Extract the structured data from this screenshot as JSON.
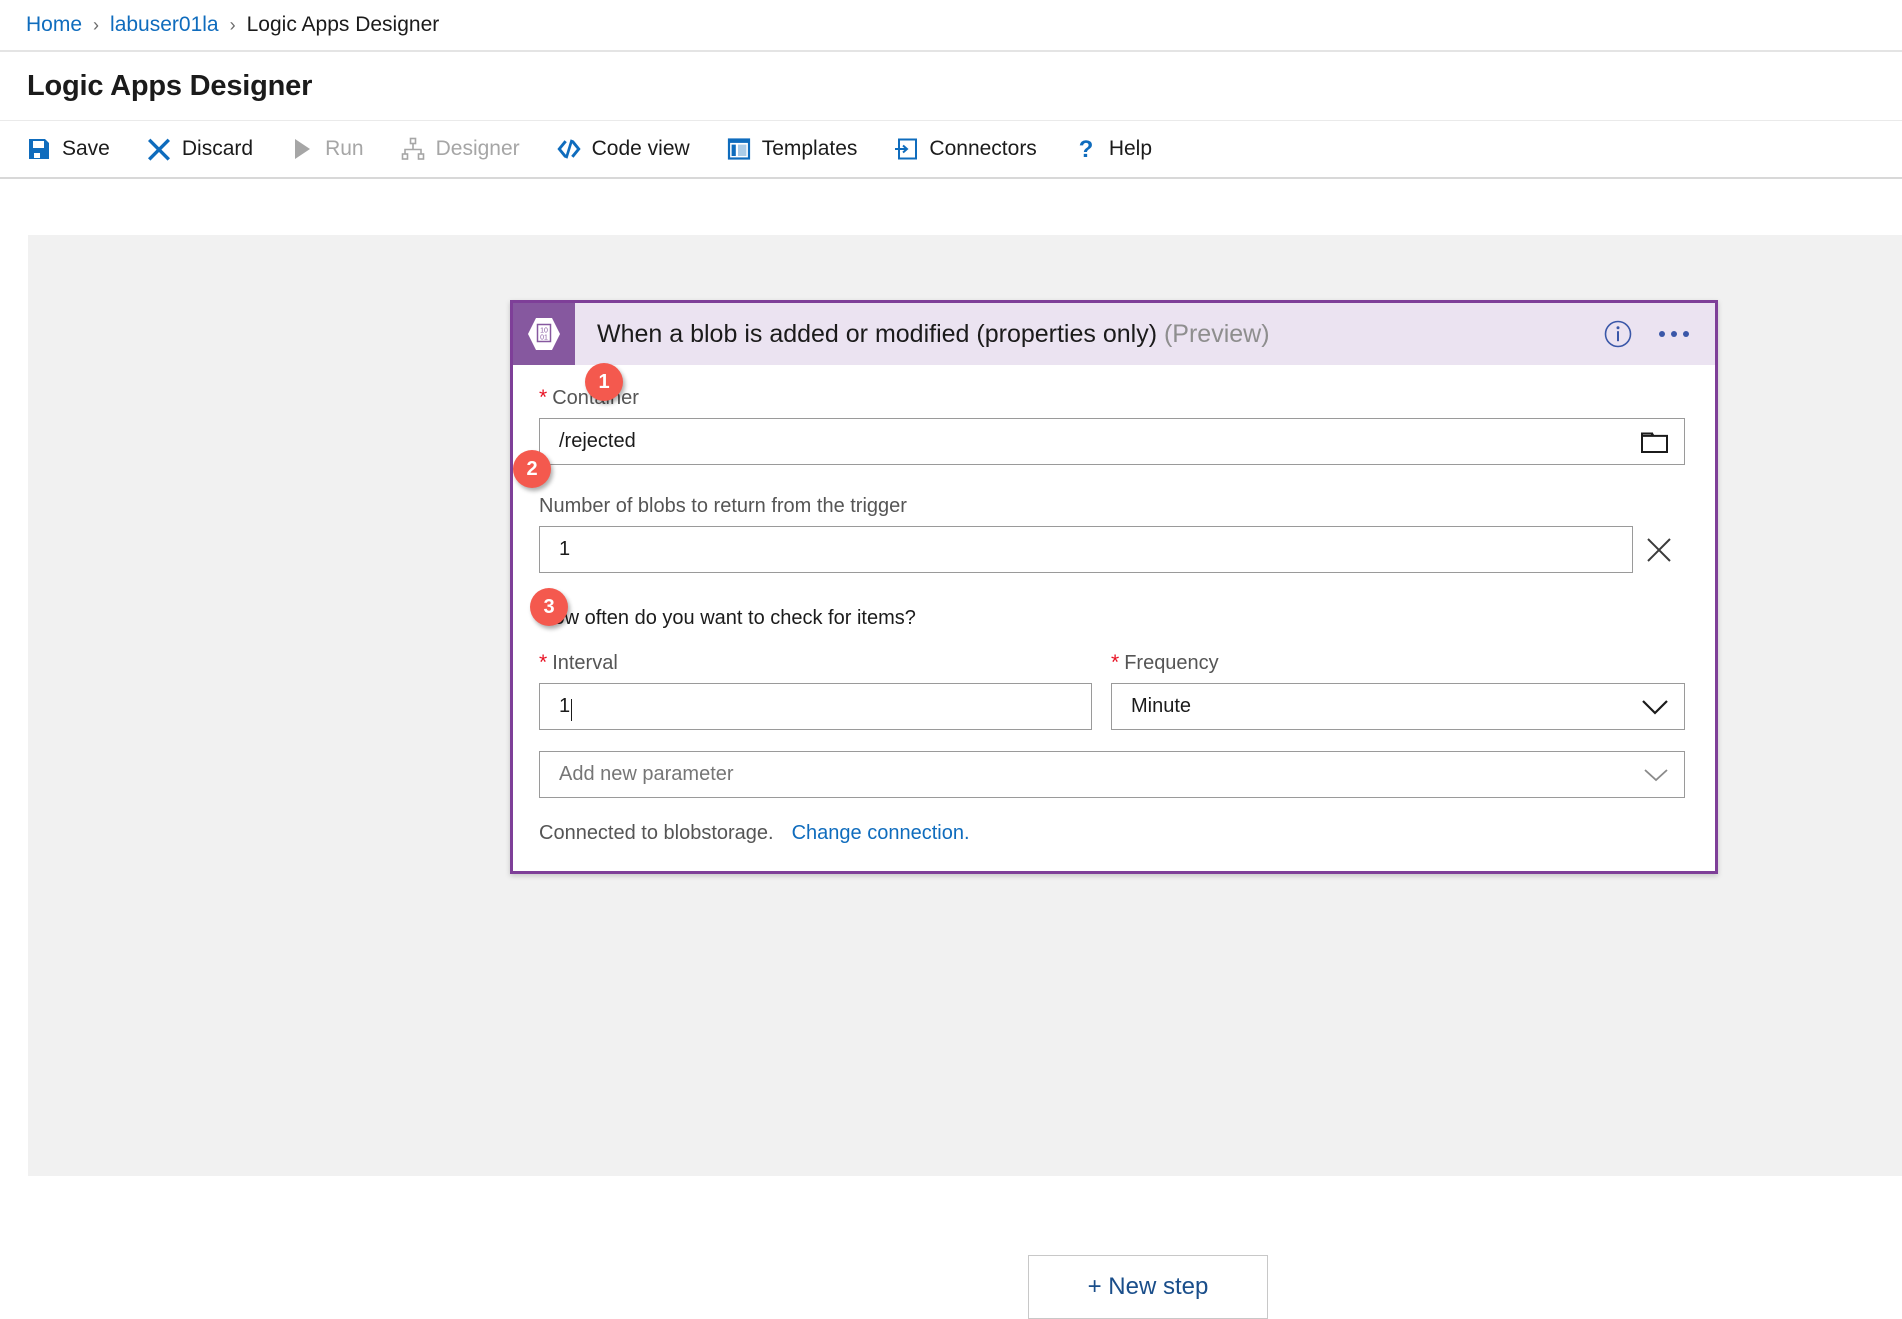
{
  "breadcrumb": {
    "items": [
      {
        "label": "Home",
        "type": "link"
      },
      {
        "label": "labuser01la",
        "type": "link"
      },
      {
        "label": "Logic Apps Designer",
        "type": "current"
      }
    ],
    "separator": "›"
  },
  "page": {
    "title": "Logic Apps Designer"
  },
  "commandbar": {
    "items": [
      {
        "label": "Save",
        "icon": "save-icon",
        "disabled": false
      },
      {
        "label": "Discard",
        "icon": "discard-x-icon",
        "disabled": false
      },
      {
        "label": "Run",
        "icon": "run-play-icon",
        "disabled": true
      },
      {
        "label": "Designer",
        "icon": "designer-sitemap-icon",
        "disabled": true
      },
      {
        "label": "Code view",
        "icon": "code-view-icon",
        "disabled": false
      },
      {
        "label": "Templates",
        "icon": "templates-icon",
        "disabled": false
      },
      {
        "label": "Connectors",
        "icon": "connectors-icon",
        "disabled": false
      },
      {
        "label": "Help",
        "icon": "help-question-icon",
        "disabled": false
      }
    ]
  },
  "trigger_card": {
    "icon": "blob-storage-icon",
    "title": "When a blob is added or modified (properties only)",
    "preview_tag": "(Preview)",
    "info_icon": "info-circle-icon",
    "more_icon": "ellipsis-icon",
    "accent_color": "#7e3f98",
    "header_bg": "#ebe3f1",
    "fields": {
      "container": {
        "label": "Container",
        "required_marker": "*",
        "value": "/rejected",
        "trailing_icon": "folder-picker-icon"
      },
      "blob_count": {
        "label": "Number of blobs to return from the trigger",
        "value": "1",
        "clear_icon": "clear-x-icon"
      },
      "question": "How often do you want to check for items?",
      "interval": {
        "label": "Interval",
        "required_marker": "*",
        "value": "1",
        "has_caret": true
      },
      "frequency": {
        "label": "Frequency",
        "required_marker": "*",
        "value": "Minute",
        "chevron_icon": "chevron-down-icon"
      },
      "add_parameter": {
        "placeholder": "Add new parameter",
        "chevron_icon": "chevron-down-icon"
      }
    },
    "connection": {
      "status_text": "Connected to blobstorage.",
      "change_link": "Change connection."
    }
  },
  "new_step": {
    "label": "+ New step"
  },
  "annotations": [
    {
      "number": "1",
      "target": "container-input"
    },
    {
      "number": "2",
      "target": "blob-count-input"
    },
    {
      "number": "3",
      "target": "interval-input"
    }
  ],
  "colors": {
    "accent_purple": "#7e3f98",
    "link_blue": "#0f6cbd",
    "badge_red": "#f4594e",
    "canvas_gray": "#f1f1f1",
    "required_red": "#e81123"
  }
}
